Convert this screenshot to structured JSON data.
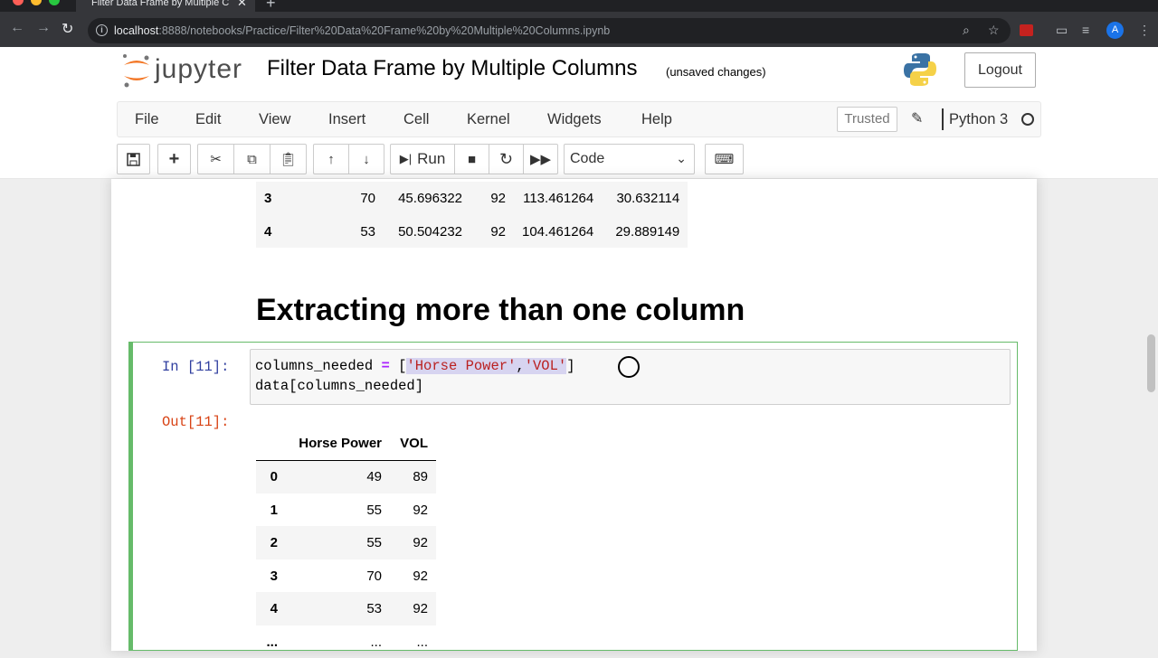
{
  "browser": {
    "tab_title": "Filter Data Frame by Multiple C",
    "url_host": "localhost",
    "url_path": ":8888/notebooks/Practice/Filter%20Data%20Frame%20by%20Multiple%20Columns.ipynb",
    "avatar_initial": "A",
    "traffic_colors": [
      "#ff5f57",
      "#febc2e",
      "#28c840"
    ]
  },
  "header": {
    "logo_text": "jupyter",
    "notebook_title": "Filter Data Frame by Multiple Columns",
    "save_status": "(unsaved changes)",
    "logout_label": "Logout"
  },
  "menu": {
    "items": [
      "File",
      "Edit",
      "View",
      "Insert",
      "Cell",
      "Kernel",
      "Widgets",
      "Help"
    ],
    "trusted_label": "Trusted",
    "kernel_name": "Python 3"
  },
  "toolbar": {
    "run_label": "Run",
    "cell_type": "Code"
  },
  "prev_output": {
    "rows": [
      {
        "index": "3",
        "c1": "70",
        "c2": "45.696322",
        "c3": "92",
        "c4": "113.461264",
        "c5": "30.632114"
      },
      {
        "index": "4",
        "c1": "53",
        "c2": "50.504232",
        "c3": "92",
        "c4": "104.461264",
        "c5": "29.889149"
      }
    ]
  },
  "markdown": {
    "heading": "Extracting more than one column"
  },
  "cell": {
    "in_prompt": "In [11]:",
    "out_prompt": "Out[11]:",
    "line1_pre": "columns_needed ",
    "line1_eq": "=",
    "line1_mid": " [",
    "line1_str1": "'Horse Power'",
    "line1_comma": ",",
    "line1_str2": "'VOL'",
    "line1_end": "]",
    "line2": "data[columns_needed]"
  },
  "output_table": {
    "headers": [
      "",
      "Horse Power",
      "VOL"
    ],
    "rows": [
      {
        "index": "0",
        "hp": "49",
        "vol": "89"
      },
      {
        "index": "1",
        "hp": "55",
        "vol": "92"
      },
      {
        "index": "2",
        "hp": "55",
        "vol": "92"
      },
      {
        "index": "3",
        "hp": "70",
        "vol": "92"
      },
      {
        "index": "4",
        "hp": "53",
        "vol": "92"
      },
      {
        "index": "...",
        "hp": "...",
        "vol": "..."
      }
    ]
  }
}
